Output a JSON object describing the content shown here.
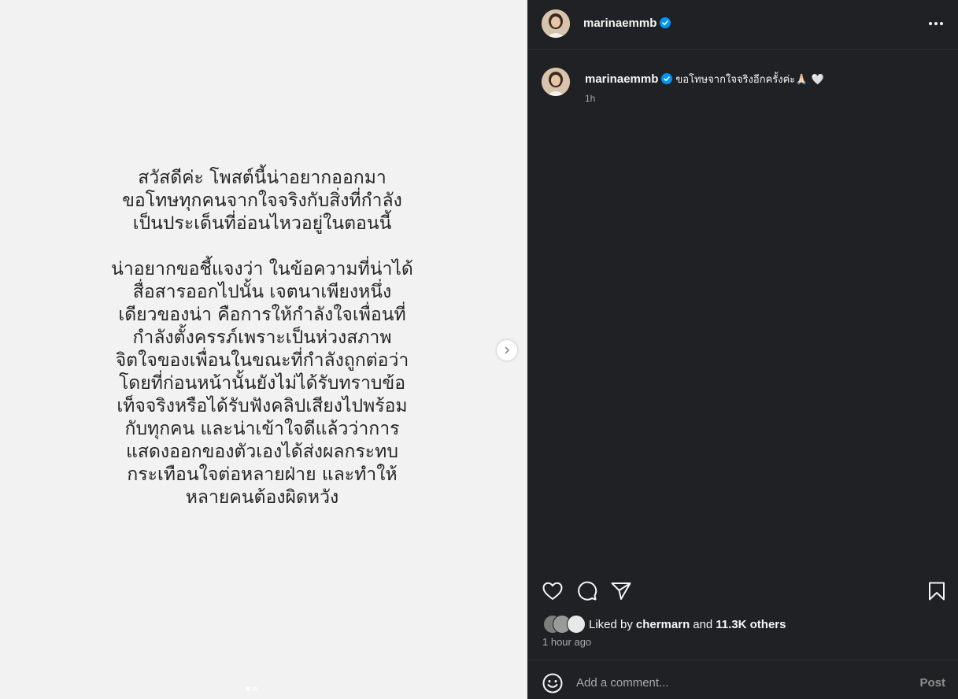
{
  "media": {
    "paragraphs": [
      [
        "สวัสดีค่ะ โพสต์นี้น่าอยากออกมา",
        "ขอโทษทุกคนจากใจจริงกับสิ่งที่กำลัง",
        "เป็นประเด็นที่อ่อนไหวอยู่ในตอนนี้"
      ],
      [
        "น่าอยากขอชี้แจงว่า ในข้อความที่น่าได้",
        "สื่อสารออกไปนั้น เจตนาเพียงหนึ่ง",
        "เดียวของน่า คือการให้กำลังใจเพื่อนที่",
        "กำลังตั้งครรภ์เพราะเป็นห่วงสภาพ",
        "จิตใจของเพื่อนในขณะที่กำลังถูกต่อว่า",
        "โดยที่ก่อนหน้านั้นยังไม่ได้รับทราบข้อ",
        "เท็จจริงหรือได้รับฟังคลิปเสียงไปพร้อม",
        "กับทุกคน และน่าเข้าใจดีแล้วว่าการ",
        "แสดงออกของตัวเองได้ส่งผลกระทบ",
        "กระเทือนใจต่อหลายฝ่าย และทำให้",
        "หลายคนต้องผิดหวัง"
      ]
    ]
  },
  "header": {
    "username": "marinaemmb",
    "more_icon": "more-horizontal-icon"
  },
  "caption": {
    "username": "marinaemmb",
    "text": "ขอโทษจากใจจริงอีกครั้งค่ะ🙏🏻 🤍",
    "time": "1h"
  },
  "likes": {
    "prefix": "Liked by",
    "user": "chermarn",
    "and": "and",
    "others": "11.3K others"
  },
  "post_time": "1 hour ago",
  "comment": {
    "placeholder": "Add a comment...",
    "post_label": "Post"
  },
  "colors": {
    "panel_bg": "#202124",
    "media_bg": "#f2f2f2",
    "verified": "#0095f6",
    "muted": "#a8a8a8"
  }
}
